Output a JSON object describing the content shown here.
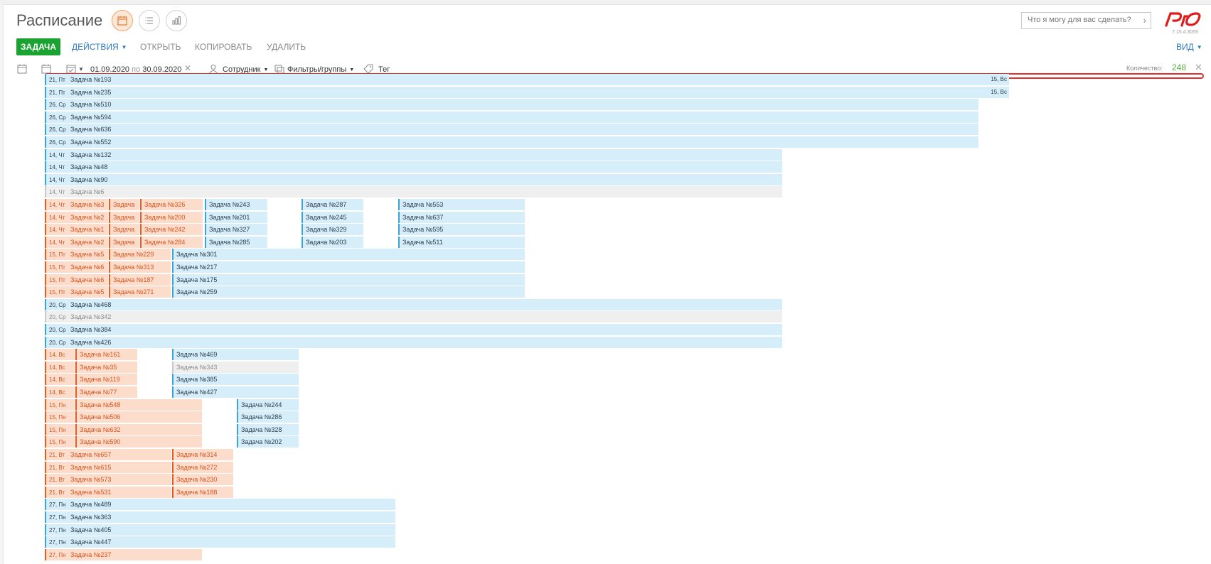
{
  "header": {
    "title": "Расписание",
    "search_placeholder": "Что я могу для вас сделать?",
    "version": "7.15.4.3055"
  },
  "actions": {
    "task": "ЗАДАЧА",
    "actions_menu": "ДЕЙСТВИЯ",
    "open": "ОТКРЫТЬ",
    "copy": "КОПИРОВАТЬ",
    "delete": "УДАЛИТЬ",
    "view": "ВИД"
  },
  "filters": {
    "date_from": "01.09.2020",
    "date_to_sep": "по",
    "date_to": "30.09.2020",
    "employee": "Сотрудник",
    "groups": "Фильтры/группы",
    "tag": "Тег",
    "count_label": "Количество:",
    "count_value": "248"
  },
  "colors": {
    "accent_green": "#1aa331",
    "blue_bar": "#d5eefa",
    "orange_bar": "#fcdccb",
    "grey_bar": "#efefef",
    "link_blue": "#2f79c0"
  },
  "rows": [
    {
      "segments": [
        {
          "c": "blue",
          "d": "21, Пт",
          "t": "Задача №193",
          "end": "15, Вс"
        }
      ]
    },
    {
      "segments": [
        {
          "c": "blue",
          "d": "21, Пт",
          "t": "Задача №235",
          "end": "15, Вс"
        }
      ]
    },
    {
      "segments": [
        {
          "c": "blue",
          "d": "26, Ср",
          "t": "Задача №510"
        }
      ]
    },
    {
      "segments": [
        {
          "c": "blue",
          "d": "26, Ср",
          "t": "Задача №594"
        }
      ]
    },
    {
      "segments": [
        {
          "c": "blue",
          "d": "26, Ср",
          "t": "Задача №636"
        }
      ]
    },
    {
      "segments": [
        {
          "c": "blue",
          "d": "26, Ср",
          "t": "Задача №552"
        }
      ]
    },
    {
      "segments": [
        {
          "c": "blue",
          "d": "14, Чт",
          "t": "Задача №132"
        }
      ]
    },
    {
      "segments": [
        {
          "c": "blue",
          "d": "14, Чт",
          "t": "Задача №48"
        }
      ]
    },
    {
      "segments": [
        {
          "c": "blue",
          "d": "14, Чт",
          "t": "Задача №90"
        }
      ]
    },
    {
      "segments": [
        {
          "c": "grey",
          "d": "14, Чт",
          "t": "Задача №6"
        }
      ]
    },
    {
      "segments": [
        {
          "c": "orange",
          "d": "14, Чт",
          "t": "Задача №3"
        },
        {
          "c": "orange",
          "t": "Задача"
        },
        {
          "c": "orange",
          "t": "Задача №326"
        },
        {
          "c": "blue",
          "t": "Задача №243"
        },
        {
          "c": "blue",
          "t": "Задача №287"
        },
        {
          "c": "blue",
          "t": "Задача №553"
        }
      ]
    },
    {
      "segments": [
        {
          "c": "orange",
          "d": "14, Чт",
          "t": "Задача №2"
        },
        {
          "c": "orange",
          "t": "Задача"
        },
        {
          "c": "orange",
          "t": "Задача №200"
        },
        {
          "c": "blue",
          "t": "Задача №201"
        },
        {
          "c": "blue",
          "t": "Задача №245"
        },
        {
          "c": "blue",
          "t": "Задача №637"
        }
      ]
    },
    {
      "segments": [
        {
          "c": "orange",
          "d": "14, Чт",
          "t": "Задача №1"
        },
        {
          "c": "orange",
          "t": "Задача"
        },
        {
          "c": "orange",
          "t": "Задача №242"
        },
        {
          "c": "blue",
          "t": "Задача №327"
        },
        {
          "c": "blue",
          "t": "Задача №329"
        },
        {
          "c": "blue",
          "t": "Задача №595"
        }
      ]
    },
    {
      "segments": [
        {
          "c": "orange",
          "d": "14, Чт",
          "t": "Задача №2"
        },
        {
          "c": "orange",
          "t": "Задача"
        },
        {
          "c": "orange",
          "t": "Задача №284"
        },
        {
          "c": "blue",
          "t": "Задача №285"
        },
        {
          "c": "blue",
          "t": "Задача №203"
        },
        {
          "c": "blue",
          "t": "Задача №511"
        }
      ]
    },
    {
      "segments": [
        {
          "c": "orange",
          "d": "15, Пт",
          "t": "Задача №5"
        },
        {
          "c": "orange",
          "t": "Задача №229"
        },
        {
          "c": "blue",
          "t": "Задача №301"
        }
      ]
    },
    {
      "segments": [
        {
          "c": "orange",
          "d": "15, Пт",
          "t": "Задача №6"
        },
        {
          "c": "orange",
          "t": "Задача №313"
        },
        {
          "c": "blue",
          "t": "Задача №217"
        }
      ]
    },
    {
      "segments": [
        {
          "c": "orange",
          "d": "15, Пт",
          "t": "Задача №6"
        },
        {
          "c": "orange",
          "t": "Задача №187"
        },
        {
          "c": "blue",
          "t": "Задача №175"
        }
      ]
    },
    {
      "segments": [
        {
          "c": "orange",
          "d": "15, Пт",
          "t": "Задача №5"
        },
        {
          "c": "orange",
          "t": "Задача №271"
        },
        {
          "c": "blue",
          "t": "Задача №259"
        }
      ]
    },
    {
      "segments": [
        {
          "c": "blue",
          "d": "20, Ср",
          "t": "Задача №468"
        }
      ]
    },
    {
      "segments": [
        {
          "c": "grey",
          "d": "20, Ср",
          "t": "Задача №342"
        }
      ]
    },
    {
      "segments": [
        {
          "c": "blue",
          "d": "20, Ср",
          "t": "Задача №384"
        }
      ]
    },
    {
      "segments": [
        {
          "c": "blue",
          "d": "20, Ср",
          "t": "Задача №426"
        }
      ]
    },
    {
      "segments": [
        {
          "c": "orange",
          "d": "14, Вс",
          "t": ""
        },
        {
          "c": "orange",
          "t": "Задача №161"
        },
        {
          "c": "blue",
          "t": "Задача №469"
        }
      ]
    },
    {
      "segments": [
        {
          "c": "orange",
          "d": "14, Вс",
          "t": ""
        },
        {
          "c": "orange",
          "t": "Задача №35"
        },
        {
          "c": "grey",
          "t": "Задача №343"
        }
      ]
    },
    {
      "segments": [
        {
          "c": "orange",
          "d": "14, Вс",
          "t": ""
        },
        {
          "c": "orange",
          "t": "Задача №119"
        },
        {
          "c": "blue",
          "t": "Задача №385"
        }
      ]
    },
    {
      "segments": [
        {
          "c": "orange",
          "d": "14, Вс",
          "t": ""
        },
        {
          "c": "orange",
          "t": "Задача №77"
        },
        {
          "c": "blue",
          "t": "Задача №427"
        }
      ]
    },
    {
      "segments": [
        {
          "c": "orange",
          "d": "15, Пн",
          "t": ""
        },
        {
          "c": "orange",
          "t": "Задача №548"
        },
        {
          "c": "blue",
          "t": "Задача №244"
        }
      ]
    },
    {
      "segments": [
        {
          "c": "orange",
          "d": "15, Пн",
          "t": ""
        },
        {
          "c": "orange",
          "t": "Задача №506"
        },
        {
          "c": "blue",
          "t": "Задача №286"
        }
      ]
    },
    {
      "segments": [
        {
          "c": "orange",
          "d": "15, Пн",
          "t": ""
        },
        {
          "c": "orange",
          "t": "Задача №632"
        },
        {
          "c": "blue",
          "t": "Задача №328"
        }
      ]
    },
    {
      "segments": [
        {
          "c": "orange",
          "d": "15, Пн",
          "t": ""
        },
        {
          "c": "orange",
          "t": "Задача №590"
        },
        {
          "c": "blue",
          "t": "Задача №202"
        }
      ]
    },
    {
      "segments": [
        {
          "c": "orange",
          "d": "21, Вт",
          "t": "Задача №657"
        },
        {
          "c": "orange",
          "t": "Задача №314"
        }
      ]
    },
    {
      "segments": [
        {
          "c": "orange",
          "d": "21, Вт",
          "t": "Задача №615"
        },
        {
          "c": "orange",
          "t": "Задача №272"
        }
      ]
    },
    {
      "segments": [
        {
          "c": "orange",
          "d": "21, Вт",
          "t": "Задача №573"
        },
        {
          "c": "orange",
          "t": "Задача №230"
        }
      ]
    },
    {
      "segments": [
        {
          "c": "orange",
          "d": "21, Вт",
          "t": "Задача №531"
        },
        {
          "c": "orange",
          "t": "Задача №188"
        }
      ]
    },
    {
      "segments": [
        {
          "c": "blue",
          "d": "27, Пн",
          "t": "Задача №489"
        }
      ]
    },
    {
      "segments": [
        {
          "c": "blue",
          "d": "27, Пн",
          "t": "Задача №363"
        }
      ]
    },
    {
      "segments": [
        {
          "c": "blue",
          "d": "27, Пн",
          "t": "Задача №405"
        }
      ]
    },
    {
      "segments": [
        {
          "c": "blue",
          "d": "27, Пн",
          "t": "Задача №447"
        }
      ]
    },
    {
      "segments": [
        {
          "c": "orange",
          "d": "27, Пн",
          "t": "Задача №237"
        }
      ]
    }
  ]
}
